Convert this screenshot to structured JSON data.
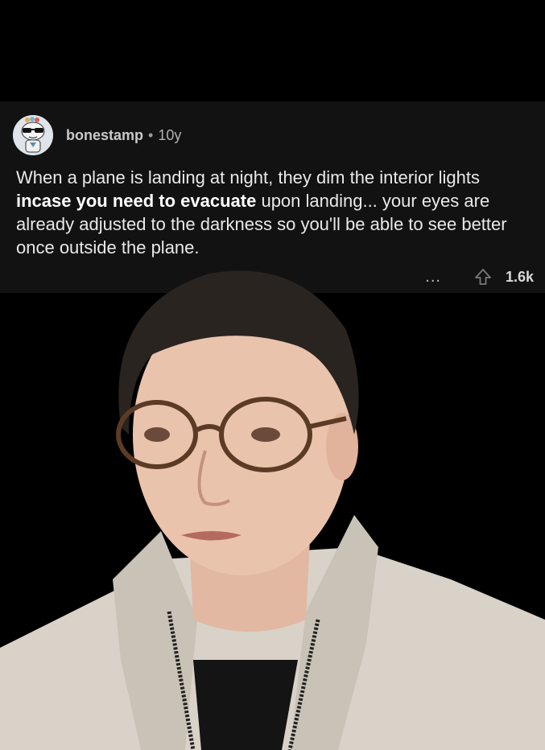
{
  "comment": {
    "username": "bonestamp",
    "separator": "•",
    "age": "10y",
    "body_before": "When a plane is landing at night, they dim the interior lights ",
    "body_bold": "incase you need to evacuate",
    "body_after": " upon landing... your eyes are already adjusted to the darkness so you'll be able to see better once outside the plane.",
    "more_label": "...",
    "score": "1.6k"
  },
  "icons": {
    "avatar": "snoo-avatar-icon",
    "upvote": "upvote-arrow-icon"
  },
  "colors": {
    "card_background": "#121212",
    "page_background": "#000000",
    "text": "#e9e9e9"
  }
}
